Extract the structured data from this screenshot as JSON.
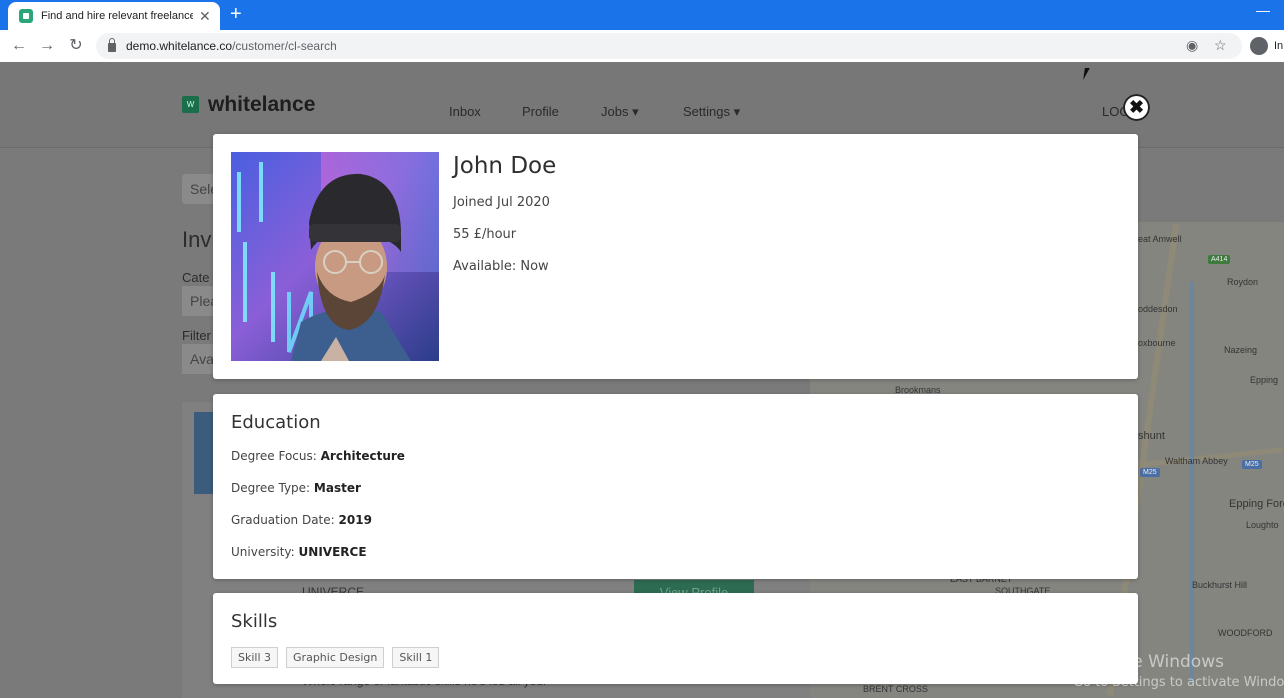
{
  "browser": {
    "tab_title": "Find and hire relevant freelancers",
    "new_tab_symbol": "+",
    "url_host": "demo.whitelance.co",
    "url_path": "/customer/cl-search",
    "profile_text": "In"
  },
  "site": {
    "logo_mark": "W",
    "logo_text": "whitelance",
    "nav": [
      "Inbox",
      "Profile",
      "Jobs ▾",
      "Settings ▾"
    ],
    "logout": "LOG"
  },
  "background_page": {
    "select_text": "Sele",
    "heading": "Inv",
    "category_label": "Cate",
    "category_placeholder": "Plea",
    "filter_label": "Filter",
    "filter_value": "Ava",
    "university_text": "UNIVERCE",
    "view_profile_label": "View Profile",
    "blurb": "Whole range of fantastic skills he's led all your",
    "map_labels": [
      "eat Amwell",
      "Roydon",
      "oddesdon",
      "oxbourne",
      "Nazeing",
      "Epping",
      "shunt",
      "Waltham Abbey",
      "Epping Fores",
      "Loughto",
      "EAST BARNET",
      "SOUTHGATE",
      "Buckhurst Hill",
      "WOODFORD",
      "BRENT CROSS",
      "Brookmans"
    ],
    "map_shields": [
      "A414",
      "M25",
      "M25",
      "M25"
    ]
  },
  "profile": {
    "name": "John Doe",
    "joined": "Joined Jul 2020",
    "rate": "55 £/hour",
    "availability": "Available: Now"
  },
  "education": {
    "title": "Education",
    "rows": [
      {
        "label": "Degree Focus: ",
        "value": "Architecture"
      },
      {
        "label": "Degree Type: ",
        "value": "Master"
      },
      {
        "label": "Graduation Date: ",
        "value": "2019"
      },
      {
        "label": "University: ",
        "value": "UNIVERCE"
      }
    ]
  },
  "skills": {
    "title": "Skills",
    "items": [
      "Skill 3",
      "Graphic Design",
      "Skill 1"
    ]
  },
  "windows_watermark": {
    "line1": "Activate Windows",
    "line2": "Go to Settings to activate Windows."
  },
  "icons": {
    "close_modal": "✖",
    "tab_close": "✕",
    "back": "←",
    "forward": "→",
    "reload": "↻",
    "eye_off": "◉",
    "star": "☆"
  }
}
